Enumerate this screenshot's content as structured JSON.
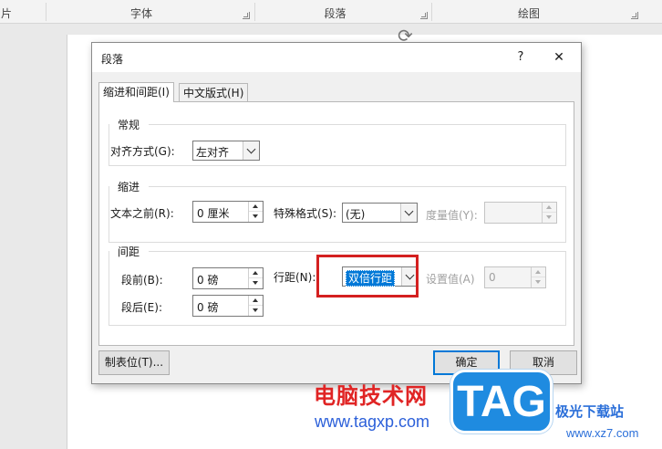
{
  "ribbon": {
    "left_partial": "片",
    "groups": [
      "字体",
      "段落",
      "绘图"
    ]
  },
  "dialog": {
    "title": "段落",
    "help": "?",
    "close": "✕",
    "tabs": [
      {
        "label": "缩进和间距(I)",
        "active": true
      },
      {
        "label": "中文版式(H)",
        "active": false
      }
    ],
    "general": {
      "heading": "常规",
      "alignment_label": "对齐方式(G):",
      "alignment_value": "左对齐"
    },
    "indent": {
      "heading": "缩进",
      "before_text_label": "文本之前(R):",
      "before_text_value": "0 厘米",
      "special_label": "特殊格式(S):",
      "special_value": "(无)",
      "measure_label": "度量值(Y):",
      "measure_value": ""
    },
    "spacing": {
      "heading": "间距",
      "before_label": "段前(B):",
      "before_value": "0 磅",
      "after_label": "段后(E):",
      "after_value": "0 磅",
      "line_spacing_label": "行距(N):",
      "line_spacing_value": "双倍行距",
      "set_value_label": "设置值(A)",
      "set_value": "0"
    },
    "buttons": {
      "tabs": "制表位(T)...",
      "ok": "确定",
      "cancel": "取消"
    }
  },
  "watermark": {
    "brand": "电脑技术网",
    "url": "www.tagxp.com",
    "logo": "TAG",
    "site_name": "极光下载站",
    "site_url": "www.xz7.com"
  },
  "colors": {
    "highlight_box": "#d42020",
    "selection": "#0078d7",
    "watermark_red": "#e02424",
    "watermark_blue": "#2b5fd9"
  }
}
